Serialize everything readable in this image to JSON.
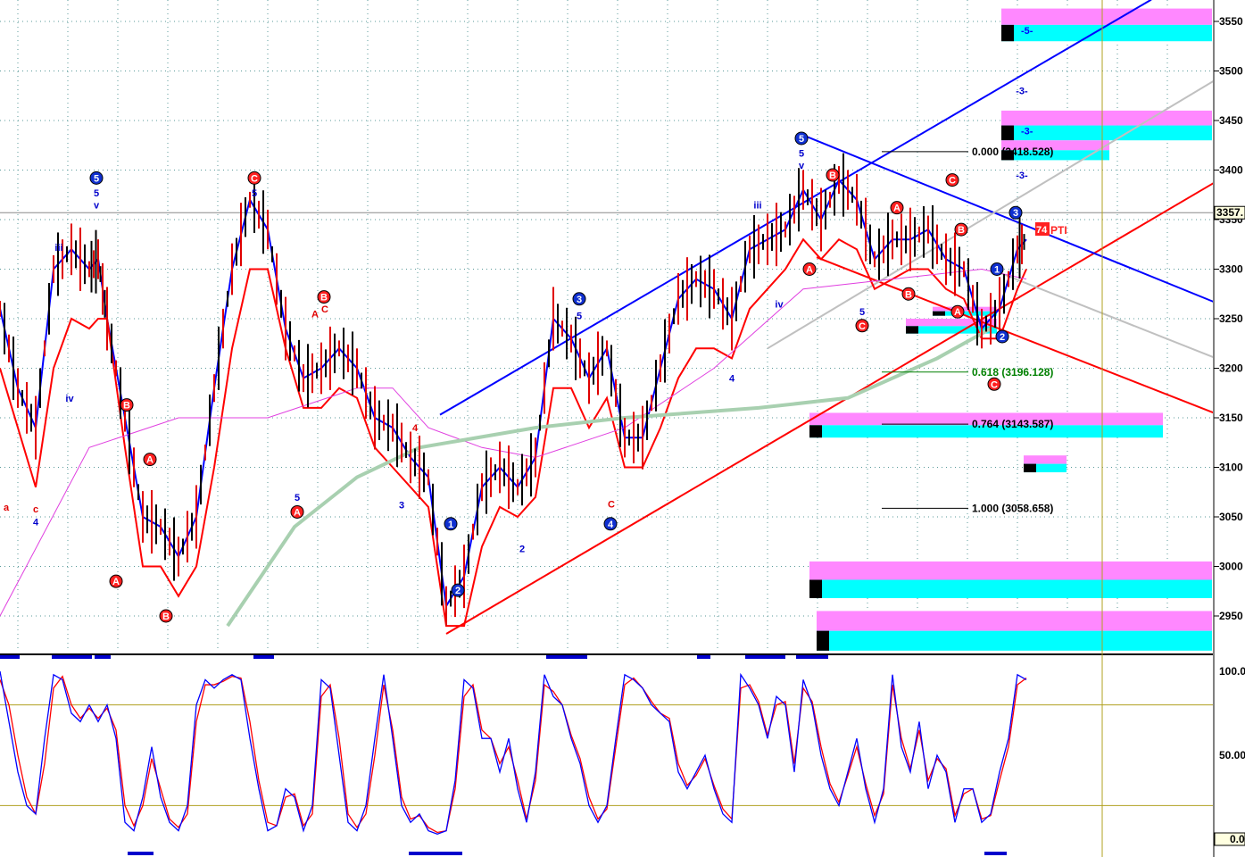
{
  "chart_data": {
    "type": "line",
    "title": "",
    "price_axis": {
      "ticks": [
        3550,
        3500,
        3450,
        3400,
        3350,
        3300,
        3250,
        3200,
        3150,
        3100,
        3050,
        3000,
        2950
      ],
      "ylim": [
        2920,
        3570
      ],
      "last_price_label": "3357."
    },
    "osc_axis": {
      "ticks": [
        "100.0",
        "50.00"
      ],
      "ylim": [
        0,
        100
      ],
      "last_label": "0.0",
      "levels": [
        80,
        20
      ]
    },
    "xlim": [
      0,
      1360
    ],
    "series": [
      {
        "name": "fast-band",
        "color": "#0000ff",
        "x": [
          0,
          20,
          40,
          60,
          80,
          100,
          110,
          120,
          140,
          160,
          180,
          200,
          220,
          240,
          260,
          280,
          300,
          320,
          340,
          360,
          380,
          400,
          420,
          440,
          460,
          480,
          500,
          520,
          540,
          560,
          580,
          600,
          620,
          640,
          660,
          680,
          700,
          720,
          740,
          760,
          780,
          800,
          820,
          840,
          860,
          880,
          900,
          920,
          940,
          960,
          980,
          1000,
          1020,
          1040,
          1060,
          1080,
          1100,
          1120,
          1140,
          1150
        ],
        "values": [
          3260,
          3180,
          3140,
          3300,
          3320,
          3300,
          3310,
          3250,
          3150,
          3050,
          3040,
          3010,
          3050,
          3180,
          3300,
          3370,
          3340,
          3240,
          3190,
          3200,
          3220,
          3200,
          3150,
          3140,
          3110,
          3090,
          2960,
          2990,
          3080,
          3100,
          3080,
          3110,
          3250,
          3230,
          3190,
          3220,
          3130,
          3130,
          3200,
          3270,
          3290,
          3280,
          3250,
          3320,
          3330,
          3340,
          3380,
          3350,
          3390,
          3370,
          3310,
          3330,
          3330,
          3340,
          3310,
          3300,
          3240,
          3260,
          3320,
          3330
        ]
      },
      {
        "name": "slow-band",
        "color": "#ff0000",
        "x": [
          0,
          20,
          40,
          60,
          80,
          100,
          110,
          120,
          140,
          160,
          180,
          200,
          220,
          240,
          260,
          280,
          300,
          320,
          340,
          360,
          380,
          400,
          420,
          440,
          460,
          480,
          500,
          520,
          540,
          560,
          580,
          600,
          620,
          640,
          660,
          680,
          700,
          720,
          740,
          760,
          780,
          800,
          820,
          840,
          860,
          880,
          900,
          920,
          940,
          960,
          980,
          1000,
          1020,
          1040,
          1060,
          1080,
          1100,
          1120,
          1140,
          1150
        ],
        "values": [
          3200,
          3140,
          3080,
          3200,
          3250,
          3240,
          3250,
          3250,
          3120,
          3000,
          3000,
          2970,
          3000,
          3100,
          3220,
          3300,
          3300,
          3220,
          3160,
          3160,
          3180,
          3170,
          3120,
          3100,
          3080,
          3060,
          2940,
          2940,
          3020,
          3060,
          3050,
          3070,
          3180,
          3180,
          3140,
          3170,
          3100,
          3100,
          3140,
          3190,
          3220,
          3220,
          3210,
          3260,
          3280,
          3300,
          3330,
          3310,
          3330,
          3320,
          3280,
          3290,
          3300,
          3300,
          3280,
          3270,
          3230,
          3230,
          3280,
          3300
        ]
      },
      {
        "name": "ma-magenta",
        "color": "#e040e0",
        "x": [
          0,
          100,
          200,
          300,
          400,
          440,
          480,
          540,
          600,
          700,
          800,
          900,
          1000,
          1100,
          1150
        ],
        "values": [
          2950,
          3120,
          3150,
          3150,
          3180,
          3180,
          3140,
          3120,
          3110,
          3140,
          3200,
          3280,
          3290,
          3300,
          3290
        ]
      },
      {
        "name": "ma-green",
        "color": "#a8d0b0",
        "x": [
          255,
          330,
          400,
          470,
          600,
          700,
          850,
          950,
          1050,
          1110
        ],
        "values": [
          2940,
          3040,
          3090,
          3120,
          3140,
          3150,
          3160,
          3170,
          3210,
          3240
        ]
      }
    ],
    "trendlines": [
      {
        "color": "#0000ff",
        "p": [
          [
            493,
            3153
          ],
          [
            1290,
            3572
          ]
        ]
      },
      {
        "color": "#ff0000",
        "p": [
          [
            500,
            2932
          ],
          [
            1360,
            3387
          ]
        ]
      },
      {
        "color": "#0000ff",
        "p": [
          [
            895,
            3437
          ],
          [
            1360,
            3267
          ]
        ]
      },
      {
        "color": "#ff0000",
        "p": [
          [
            915,
            3312
          ],
          [
            1360,
            3155
          ]
        ]
      },
      {
        "color": "#c0c0c0",
        "p": [
          [
            860,
            3220
          ],
          [
            1360,
            3490
          ]
        ]
      },
      {
        "color": "#c0c0c0",
        "p": [
          [
            1110,
            3300
          ],
          [
            1360,
            3211
          ]
        ]
      }
    ],
    "fib_levels": [
      {
        "text": "0.000 (3418.528)",
        "price": 3418.528,
        "color": "#000000"
      },
      {
        "text": "0.618 (3196.128)",
        "price": 3196.128,
        "color": "#008000"
      },
      {
        "text": "0.764 (3143.587)",
        "price": 3143.587,
        "color": "#000000"
      },
      {
        "text": "1.000 (3058.658)",
        "price": 3058.658,
        "color": "#000000"
      }
    ],
    "zones": [
      {
        "x0": 1122,
        "x1": 1358,
        "top": 3563,
        "bottom": 3530,
        "label": "-5-"
      },
      {
        "x0": 1122,
        "x1": 1358,
        "top": 3460,
        "bottom": 3430,
        "label": "-3-"
      },
      {
        "x0": 1122,
        "x1": 1243,
        "top": 3430,
        "bottom": 3410,
        "label": ""
      },
      {
        "x0": 907,
        "x1": 1303,
        "top": 3155,
        "bottom": 3130,
        "label": ""
      },
      {
        "x0": 1147,
        "x1": 1195,
        "top": 3112,
        "bottom": 3095,
        "label": ""
      },
      {
        "x0": 907,
        "x1": 1358,
        "top": 3005,
        "bottom": 2968,
        "label": ""
      },
      {
        "x0": 915,
        "x1": 1358,
        "top": 2955,
        "bottom": 2915,
        "label": ""
      },
      {
        "x0": 1015,
        "x1": 1117,
        "top": 3250,
        "bottom": 3235,
        "label": ""
      },
      {
        "x0": 1045,
        "x1": 1117,
        "top": 3262,
        "bottom": 3253,
        "label": ""
      }
    ],
    "annotations": [
      {
        "t": "5",
        "x": 108,
        "p": 3392,
        "s": "bc"
      },
      {
        "t": "5",
        "x": 108,
        "p": 3377,
        "s": "b"
      },
      {
        "t": "v",
        "x": 108,
        "p": 3365,
        "s": "b"
      },
      {
        "t": "C",
        "x": 285,
        "p": 3392,
        "s": "rc"
      },
      {
        "t": "5",
        "x": 285,
        "p": 3377,
        "s": "b"
      },
      {
        "t": "B",
        "x": 363,
        "p": 3272,
        "s": "rc"
      },
      {
        "t": "A",
        "x": 353,
        "p": 3255,
        "s": "r"
      },
      {
        "t": "C",
        "x": 364,
        "p": 3260,
        "s": "r"
      },
      {
        "t": "iii",
        "x": 66,
        "p": 3322,
        "s": "b"
      },
      {
        "t": "iv",
        "x": 78,
        "p": 3170,
        "s": "b"
      },
      {
        "t": "c",
        "x": 40,
        "p": 3058,
        "s": "r"
      },
      {
        "t": "4",
        "x": 40,
        "p": 3045,
        "s": "b"
      },
      {
        "t": "B",
        "x": 142,
        "p": 3163,
        "s": "rc"
      },
      {
        "t": "A",
        "x": 168,
        "p": 3108,
        "s": "rc"
      },
      {
        "t": "A",
        "x": 130,
        "p": 2985,
        "s": "rc"
      },
      {
        "t": "B",
        "x": 186,
        "p": 2950,
        "s": "rc"
      },
      {
        "t": "A",
        "x": 333,
        "p": 3055,
        "s": "rc"
      },
      {
        "t": "5",
        "x": 333,
        "p": 3070,
        "s": "b"
      },
      {
        "t": "1",
        "x": 505,
        "p": 3043,
        "s": "bc"
      },
      {
        "t": "2",
        "x": 513,
        "p": 2976,
        "s": "bc"
      },
      {
        "t": "3",
        "x": 649,
        "p": 3270,
        "s": "bc"
      },
      {
        "t": "5",
        "x": 649,
        "p": 3253,
        "s": "b"
      },
      {
        "t": "4",
        "x": 684,
        "p": 3043,
        "s": "bc"
      },
      {
        "t": "C",
        "x": 685,
        "p": 3063,
        "s": "r"
      },
      {
        "t": "5",
        "x": 898,
        "p": 3432,
        "s": "bc"
      },
      {
        "t": "5",
        "x": 898,
        "p": 3417,
        "s": "b"
      },
      {
        "t": "v",
        "x": 898,
        "p": 3405,
        "s": "b"
      },
      {
        "t": "B",
        "x": 933,
        "p": 3395,
        "s": "rc"
      },
      {
        "t": "A",
        "x": 907,
        "p": 3300,
        "s": "rc"
      },
      {
        "t": "A",
        "x": 1005,
        "p": 3362,
        "s": "rc"
      },
      {
        "t": "C",
        "x": 1067,
        "p": 3390,
        "s": "rc"
      },
      {
        "t": "B",
        "x": 1077,
        "p": 3340,
        "s": "rc"
      },
      {
        "t": "B",
        "x": 1018,
        "p": 3275,
        "s": "rc"
      },
      {
        "t": "5",
        "x": 966,
        "p": 3257,
        "s": "b"
      },
      {
        "t": "C",
        "x": 966,
        "p": 3243,
        "s": "rc"
      },
      {
        "t": "A",
        "x": 1073,
        "p": 3257,
        "s": "rc"
      },
      {
        "t": "1",
        "x": 1117,
        "p": 3300,
        "s": "bc"
      },
      {
        "t": "2",
        "x": 1123,
        "p": 3232,
        "s": "bc"
      },
      {
        "t": "C",
        "x": 1114,
        "p": 3184,
        "s": "rc"
      },
      {
        "t": "3",
        "x": 1138,
        "p": 3357,
        "s": "bc"
      },
      {
        "t": "-3-",
        "x": 1145,
        "p": 3395,
        "s": "b"
      },
      {
        "t": "-3-",
        "x": 1145,
        "p": 3480,
        "s": "b"
      },
      {
        "t": "iii",
        "x": 849,
        "p": 3365,
        "s": "b"
      },
      {
        "t": "iv",
        "x": 873,
        "p": 3265,
        "s": "b"
      },
      {
        "t": "4",
        "x": 820,
        "p": 3190,
        "s": "b"
      },
      {
        "t": "4",
        "x": 465,
        "p": 3140,
        "s": "r"
      },
      {
        "t": "3",
        "x": 450,
        "p": 3062,
        "s": "b"
      },
      {
        "t": "2",
        "x": 585,
        "p": 3018,
        "s": "b"
      },
      {
        "t": "a",
        "x": 7,
        "p": 3060,
        "s": "r"
      }
    ],
    "pti_label": "74",
    "pti_text": "PTI",
    "oscillator": {
      "x": [
        0,
        10,
        20,
        30,
        40,
        50,
        60,
        70,
        80,
        90,
        100,
        110,
        120,
        130,
        140,
        150,
        160,
        170,
        180,
        190,
        200,
        210,
        220,
        230,
        240,
        250,
        260,
        270,
        280,
        290,
        300,
        310,
        320,
        330,
        340,
        350,
        360,
        370,
        380,
        390,
        400,
        410,
        420,
        430,
        440,
        450,
        460,
        470,
        480,
        490,
        500,
        510,
        520,
        530,
        540,
        550,
        560,
        570,
        580,
        590,
        600,
        610,
        620,
        630,
        640,
        650,
        660,
        670,
        680,
        690,
        700,
        710,
        720,
        730,
        740,
        750,
        760,
        770,
        780,
        790,
        800,
        810,
        820,
        830,
        840,
        850,
        860,
        870,
        880,
        890,
        900,
        910,
        920,
        930,
        940,
        950,
        960,
        970,
        980,
        990,
        1000,
        1010,
        1020,
        1030,
        1040,
        1050,
        1060,
        1070,
        1080,
        1090,
        1100,
        1110,
        1120,
        1130,
        1140,
        1150
      ],
      "blue": [
        100,
        70,
        40,
        20,
        15,
        60,
        98,
        95,
        75,
        70,
        80,
        70,
        80,
        60,
        10,
        5,
        25,
        55,
        25,
        10,
        5,
        20,
        80,
        95,
        90,
        95,
        98,
        95,
        60,
        30,
        5,
        8,
        30,
        25,
        5,
        20,
        95,
        90,
        50,
        10,
        5,
        20,
        60,
        98,
        60,
        20,
        10,
        15,
        5,
        3,
        5,
        35,
        95,
        90,
        60,
        60,
        40,
        60,
        30,
        10,
        40,
        98,
        85,
        80,
        60,
        45,
        20,
        10,
        20,
        60,
        98,
        95,
        90,
        80,
        75,
        70,
        40,
        30,
        40,
        50,
        30,
        15,
        10,
        98,
        90,
        80,
        60,
        85,
        80,
        40,
        95,
        80,
        50,
        30,
        20,
        40,
        60,
        30,
        10,
        30,
        98,
        55,
        40,
        70,
        30,
        50,
        40,
        10,
        30,
        30,
        10,
        15,
        40,
        60,
        98,
        95
      ],
      "red": [
        95,
        80,
        50,
        25,
        15,
        45,
        90,
        97,
        80,
        72,
        78,
        72,
        78,
        65,
        20,
        8,
        20,
        48,
        30,
        12,
        7,
        15,
        70,
        92,
        92,
        94,
        97,
        96,
        70,
        35,
        10,
        8,
        25,
        27,
        8,
        15,
        85,
        92,
        60,
        15,
        7,
        15,
        50,
        92,
        65,
        25,
        12,
        14,
        7,
        4,
        5,
        30,
        85,
        92,
        65,
        60,
        45,
        55,
        35,
        12,
        35,
        92,
        88,
        80,
        62,
        48,
        25,
        12,
        18,
        55,
        92,
        96,
        90,
        82,
        75,
        72,
        45,
        32,
        38,
        48,
        32,
        18,
        12,
        90,
        92,
        82,
        62,
        80,
        82,
        45,
        90,
        82,
        55,
        33,
        22,
        38,
        55,
        33,
        14,
        27,
        92,
        60,
        42,
        65,
        35,
        48,
        42,
        14,
        27,
        30,
        12,
        14,
        35,
        55,
        92,
        96
      ]
    }
  }
}
